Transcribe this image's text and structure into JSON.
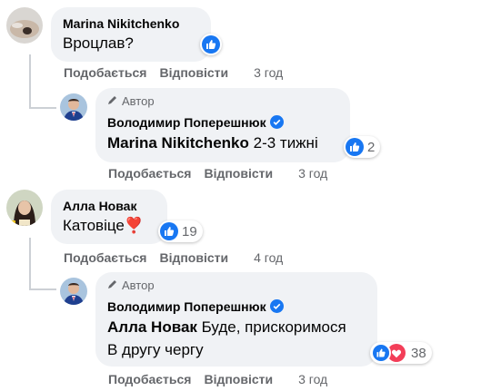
{
  "comments": [
    {
      "author": "Marina Nikitchenko",
      "text": "Вроцлав?",
      "actions": {
        "like": "Подобається",
        "reply": "Відповісти",
        "time": "3 год"
      },
      "reply": {
        "badge": "Автор",
        "author": "Володимир Поперешнюк",
        "mention": "Marina Nikitchenko",
        "text": "2-3 тижні",
        "reaction_count": "2",
        "actions": {
          "like": "Подобається",
          "reply": "Відповісти",
          "time": "3 год"
        }
      }
    },
    {
      "author": "Алла Новак",
      "text": "Катовіце❣️",
      "reaction_count": "19",
      "actions": {
        "like": "Подобається",
        "reply": "Відповісти",
        "time": "4 год"
      },
      "reply": {
        "badge": "Автор",
        "author": "Володимир Поперешнюк",
        "mention": "Алла Новак",
        "text_line1": "Буде, прискоримося",
        "text_line2": "В другу чергу",
        "reaction_count": "38",
        "actions": {
          "like": "Подобається",
          "reply": "Відповісти",
          "time": "3 год"
        }
      }
    }
  ],
  "icons": {
    "like": "like-icon",
    "love": "love-icon",
    "pencil": "pencil-icon",
    "verified": "verified-badge-icon"
  },
  "colors": {
    "like_blue": "#1877f2",
    "love_red": "#f33e58",
    "bubble_bg": "#f0f2f5",
    "meta_gray": "#65676b"
  }
}
